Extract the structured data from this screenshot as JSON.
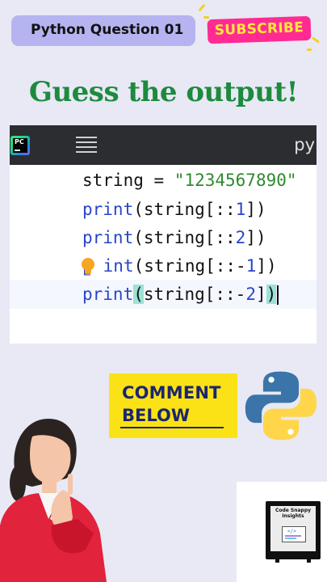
{
  "header": {
    "question_label": "Python Question 01",
    "subscribe_label": "SUBSCRIBE"
  },
  "headline": "Guess the output!",
  "editor": {
    "toolbar": {
      "app_icon_text": "PC",
      "menu_icon": "hamburger-menu-icon",
      "file_type_text": "py"
    },
    "lines": [
      {
        "t1": "string",
        "t2": " = ",
        "t3": "\"1234567890\""
      },
      {
        "kw": "print",
        "open": "(",
        "mid": "string[::",
        "num": "1",
        "close": "])"
      },
      {
        "kw": "print",
        "open": "(",
        "mid": "string[::",
        "num": "2",
        "close": "])"
      },
      {
        "kw": "p",
        "kw2": "int",
        "open": "(",
        "mid": "string[::-",
        "num": "1",
        "close": "])"
      },
      {
        "kw": "print",
        "open": "(",
        "mid": "string[::-",
        "num": "2",
        "close": "])"
      }
    ]
  },
  "cta": {
    "line1": "COMMENT",
    "line2": "BELOW"
  },
  "badge": {
    "title": "Code Snappy Insights",
    "screen_text": "</>"
  },
  "colors": {
    "headline": "#1e8a3e",
    "subscribe_bg": "#ff2b93",
    "subscribe_text": "#ffe93a",
    "question_bg": "#b5b3f0",
    "cta_bg": "#fbe216",
    "cta_text": "#1a2670",
    "keyword": "#2845c9",
    "string": "#2e8a2e",
    "bracket_highlight": "#9ce2d6"
  }
}
